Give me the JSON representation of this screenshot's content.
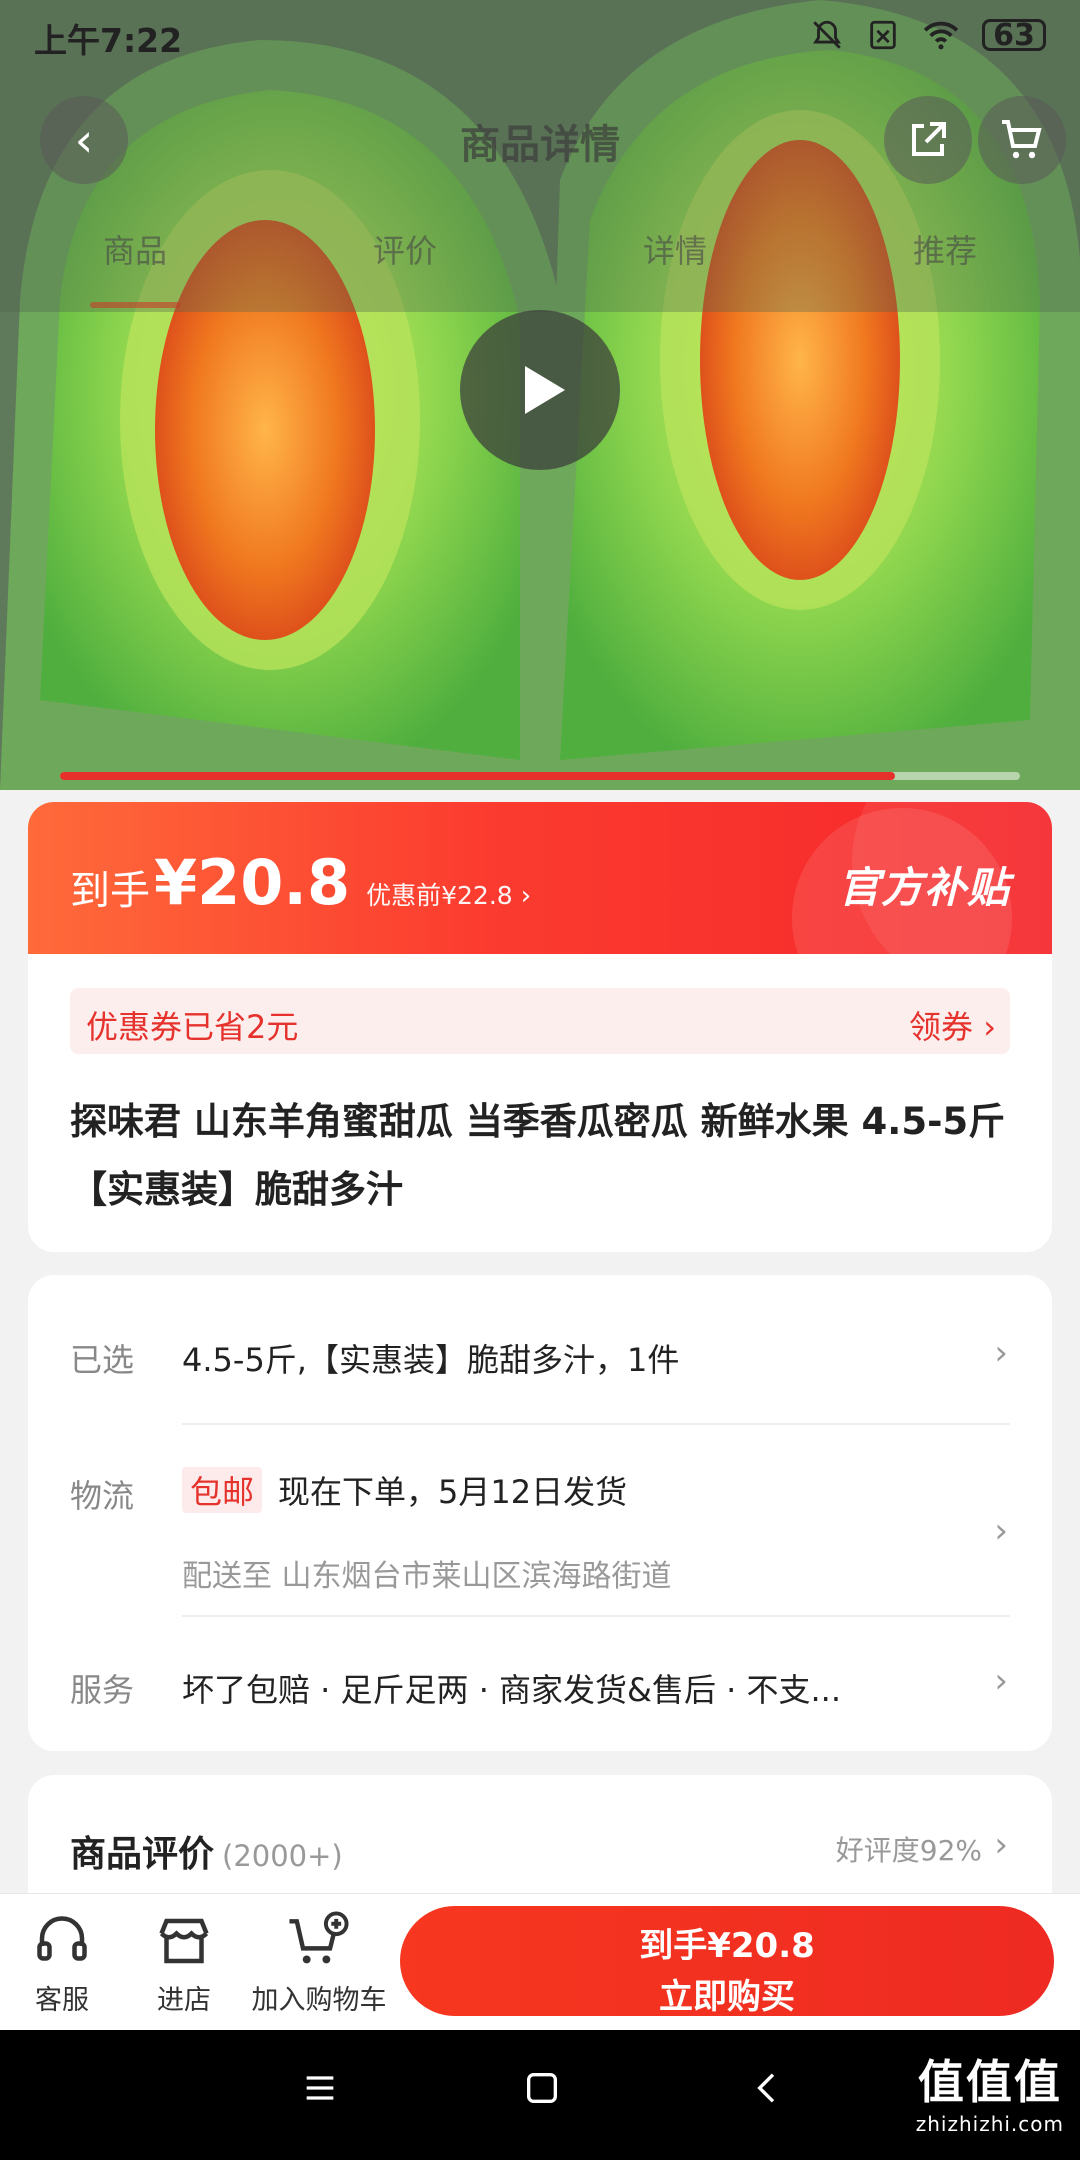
{
  "status_bar": {
    "time": "上午7:22",
    "battery": "63"
  },
  "nav": {
    "title": "商品详情",
    "back_icon": "chevron-left-icon",
    "share_icon": "share-icon",
    "cart_icon": "cart-icon"
  },
  "tabs": [
    {
      "label": "商品",
      "active": true
    },
    {
      "label": "评价",
      "active": false
    },
    {
      "label": "详情",
      "active": false
    },
    {
      "label": "推荐",
      "active": false
    }
  ],
  "hero": {
    "video_progress": 0.87
  },
  "price": {
    "prefix": "到手",
    "value": "¥20.8",
    "before": "优惠前¥22.8",
    "arrow": "›",
    "badge": "官方补贴"
  },
  "coupon": {
    "text": "优惠券已省2元",
    "action": "领券 ›"
  },
  "product": {
    "title": "探味君 山东羊角蜜甜瓜 当季香瓜密瓜 新鲜水果 4.5-5斤【实惠装】脆甜多汁"
  },
  "options": {
    "selected": {
      "label": "已选",
      "value": "4.5-5斤,【实惠装】脆甜多汁，1件"
    },
    "shipping": {
      "label": "物流",
      "tag": "包邮",
      "value": "现在下单，5月12日发货",
      "sub": "配送至   山东烟台市莱山区滨海路街道"
    },
    "service": {
      "label": "服务",
      "value": "坏了包赔  ·  足斤足两  ·  商家发货&售后  ·  不支..."
    }
  },
  "reviews": {
    "title": "商品评价",
    "count": "(2000+)",
    "rate": "好评度92%"
  },
  "bottom": {
    "service_label": "客服",
    "store_label": "进店",
    "add_cart_label": "加入购物车",
    "buy_line1": "到手¥20.8",
    "buy_line2": "立即购买"
  },
  "watermark": {
    "main": "值值值",
    "sub": "zhizhizhi.com"
  },
  "colors": {
    "accent": "#f5272b",
    "coupon_bg": "#fdeeee"
  }
}
